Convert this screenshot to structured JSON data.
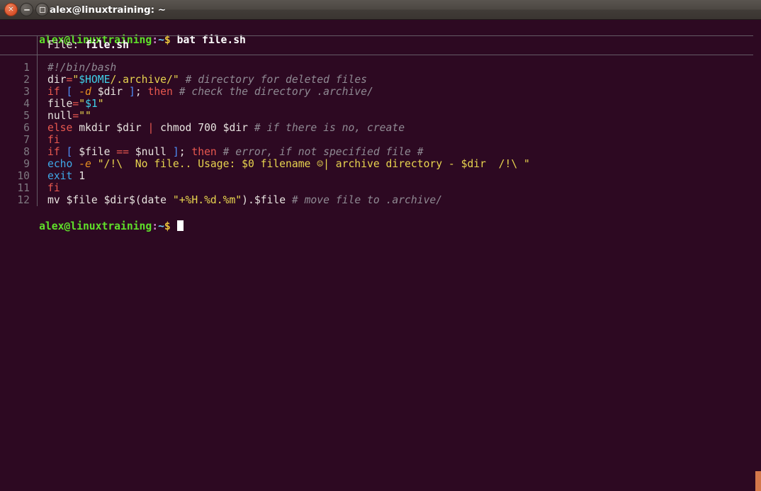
{
  "window": {
    "title": "alex@linuxtraining: ~",
    "buttons": [
      {
        "name": "close",
        "glyph": "✕"
      },
      {
        "name": "minimize",
        "glyph": ""
      },
      {
        "name": "maximize",
        "glyph": ""
      }
    ]
  },
  "terminal": {
    "background": "#2d0922",
    "foreground": "#e8e4e0",
    "prompt_user_host": "alex@linuxtraining",
    "prompt_colon": ":",
    "prompt_path": "~",
    "prompt_dollar": "$",
    "command": " bat file.sh",
    "command_line_full": "alex@linuxtraining:~$ bat file.sh",
    "final_prompt_full": "alex@linuxtraining:~$",
    "cursor": "block"
  },
  "bat": {
    "file_label": "File:",
    "file_name": "file.sh",
    "line_numbers": [
      "1",
      "2",
      "3",
      "4",
      "5",
      "6",
      "7",
      "8",
      "9",
      "10",
      "11",
      "12"
    ],
    "lines": [
      {
        "number": "1",
        "text": "#!/bin/bash",
        "tokens": [
          {
            "t": "#!/bin/bash",
            "c": "c-comment"
          }
        ]
      },
      {
        "number": "2",
        "text": "dir=\"$HOME/.archive/\" # directory for deleted files",
        "tokens": [
          {
            "t": "dir",
            "c": "c-plain"
          },
          {
            "t": "=",
            "c": "c-op"
          },
          {
            "t": "\"",
            "c": "c-str"
          },
          {
            "t": "$HOME",
            "c": "c-var"
          },
          {
            "t": "/.archive/\"",
            "c": "c-str"
          },
          {
            "t": " ",
            "c": "c-plain"
          },
          {
            "t": "# directory for deleted files",
            "c": "c-comment"
          }
        ]
      },
      {
        "number": "3",
        "text": "if [ -d $dir ]; then # check the directory .archive/",
        "tokens": [
          {
            "t": "if",
            "c": "c-kw"
          },
          {
            "t": " ",
            "c": "c-plain"
          },
          {
            "t": "[",
            "c": "c-bracket"
          },
          {
            "t": " ",
            "c": "c-plain"
          },
          {
            "t": "-d",
            "c": "c-flag"
          },
          {
            "t": " $dir ",
            "c": "c-plain"
          },
          {
            "t": "]",
            "c": "c-bracket"
          },
          {
            "t": ";",
            "c": "c-plain"
          },
          {
            "t": " ",
            "c": "c-plain"
          },
          {
            "t": "then",
            "c": "c-kw"
          },
          {
            "t": " ",
            "c": "c-plain"
          },
          {
            "t": "# check the directory .archive/",
            "c": "c-comment"
          }
        ]
      },
      {
        "number": "4",
        "text": "file=\"$1\"",
        "tokens": [
          {
            "t": "file",
            "c": "c-plain"
          },
          {
            "t": "=",
            "c": "c-op"
          },
          {
            "t": "\"",
            "c": "c-str"
          },
          {
            "t": "$1",
            "c": "c-var"
          },
          {
            "t": "\"",
            "c": "c-str"
          }
        ]
      },
      {
        "number": "5",
        "text": "null=\"\"",
        "tokens": [
          {
            "t": "null",
            "c": "c-plain"
          },
          {
            "t": "=",
            "c": "c-op"
          },
          {
            "t": "\"\"",
            "c": "c-str"
          }
        ]
      },
      {
        "number": "6",
        "text": "else mkdir $dir | chmod 700 $dir # if there is no, create",
        "tokens": [
          {
            "t": "else",
            "c": "c-kw"
          },
          {
            "t": " mkdir $dir ",
            "c": "c-plain"
          },
          {
            "t": "|",
            "c": "c-op"
          },
          {
            "t": " chmod 700 $dir ",
            "c": "c-plain"
          },
          {
            "t": "# if there is no, create",
            "c": "c-comment"
          }
        ]
      },
      {
        "number": "7",
        "text": "fi",
        "tokens": [
          {
            "t": "fi",
            "c": "c-kw"
          }
        ]
      },
      {
        "number": "8",
        "text": "if [ $file == $null ]; then # error, if not specified file #",
        "tokens": [
          {
            "t": "if",
            "c": "c-kw"
          },
          {
            "t": " ",
            "c": "c-plain"
          },
          {
            "t": "[",
            "c": "c-bracket"
          },
          {
            "t": " $file ",
            "c": "c-plain"
          },
          {
            "t": "==",
            "c": "c-op"
          },
          {
            "t": " $null ",
            "c": "c-plain"
          },
          {
            "t": "]",
            "c": "c-bracket"
          },
          {
            "t": ";",
            "c": "c-plain"
          },
          {
            "t": " ",
            "c": "c-plain"
          },
          {
            "t": "then",
            "c": "c-kw"
          },
          {
            "t": " ",
            "c": "c-plain"
          },
          {
            "t": "# error, if not specified file #",
            "c": "c-comment"
          }
        ]
      },
      {
        "number": "9",
        "text": "echo -e \"/!\\  No file.. Usage: $0 filename ☺| archive directory - $dir  /!\\ \"",
        "tokens": [
          {
            "t": "echo",
            "c": "c-func"
          },
          {
            "t": " ",
            "c": "c-plain"
          },
          {
            "t": "-e",
            "c": "c-flag"
          },
          {
            "t": " ",
            "c": "c-plain"
          },
          {
            "t": "\"/!\\  No file.. Usage: $0 filename ☺| archive directory - $dir  /!\\ \"",
            "c": "c-str"
          }
        ]
      },
      {
        "number": "10",
        "text": "exit 1",
        "tokens": [
          {
            "t": "exit",
            "c": "c-func"
          },
          {
            "t": " ",
            "c": "c-plain"
          },
          {
            "t": "1",
            "c": "c-num"
          }
        ]
      },
      {
        "number": "11",
        "text": "fi",
        "tokens": [
          {
            "t": "fi",
            "c": "c-kw"
          }
        ]
      },
      {
        "number": "12",
        "text": "mv $file $dir$(date \"+%H.%d.%m\").$file # move file to .archive/",
        "tokens": [
          {
            "t": "mv $file $dir$(date ",
            "c": "c-plain"
          },
          {
            "t": "\"+%H.%d.%m\"",
            "c": "c-str"
          },
          {
            "t": ").$file ",
            "c": "c-plain"
          },
          {
            "t": "# move file to .archive/",
            "c": "c-comment"
          }
        ]
      }
    ]
  },
  "scrollbar": {
    "color": "#d4784b"
  }
}
